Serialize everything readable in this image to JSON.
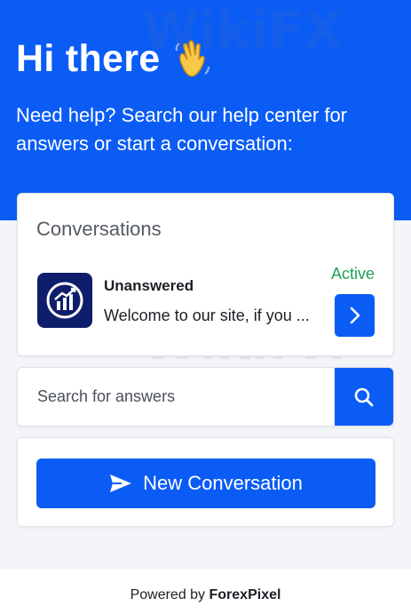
{
  "header": {
    "greeting": "Hi there",
    "greeting_icon": "waving-hand-icon",
    "subtitle": "Need help? Search our help center for answers or start a conversation:"
  },
  "conversations": {
    "title": "Conversations",
    "items": [
      {
        "avatar_icon": "chart-logo-icon",
        "name": "Unanswered",
        "preview": "Welcome to our site, if you ...",
        "status": "Active",
        "status_color": "#1fa15a",
        "open_icon": "chevron-right-icon"
      }
    ]
  },
  "search": {
    "placeholder": "Search for answers",
    "button_icon": "search-icon"
  },
  "new_conversation": {
    "label": "New Conversation",
    "icon": "send-icon"
  },
  "footer": {
    "prefix": "Powered by ",
    "brand": "ForexPixel"
  },
  "watermark": {
    "text": "WikiFX"
  },
  "colors": {
    "accent": "#0a5cf5",
    "header_bg": "#0a5cf5",
    "avatar_bg": "#0f1e6b",
    "page_bg": "#f4f5f8"
  }
}
